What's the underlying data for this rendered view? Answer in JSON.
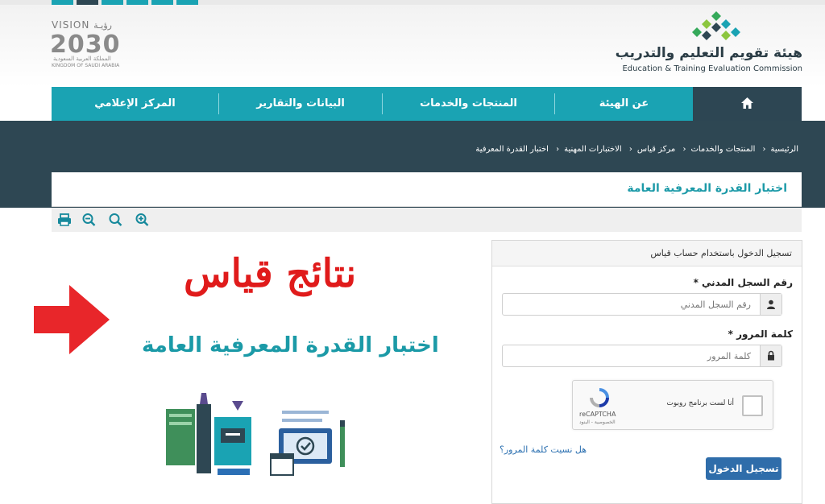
{
  "org": {
    "name_ar": "هيئة تقويم التعليم والتدريب",
    "name_en": "Education & Training Evaluation Commission"
  },
  "vision": {
    "label_en": "VISION",
    "label_ar": "رؤيـة",
    "year": "2030",
    "country_ar": "المملكة العربية السعودية",
    "country_en": "KINGDOM OF SAUDI ARABIA"
  },
  "nav": {
    "home_icon": "home-icon",
    "items": [
      "عن الهيئة",
      "المنتجات والخدمات",
      "البيانات والتقارير",
      "المركز الإعلامي"
    ]
  },
  "breadcrumb": [
    "الرئيسية",
    "المنتجات والخدمات",
    "مركز قياس",
    "الاختبارات المهنية",
    "اختبار القدرة المعرفية"
  ],
  "page": {
    "title": "اختبار القدرة المعرفية العامة"
  },
  "toolbar": {
    "tools": [
      "print-icon",
      "zoom-out-icon",
      "zoom-reset-icon",
      "zoom-in-icon"
    ]
  },
  "banner": {
    "headline": "نتائج قياس",
    "subtitle": "اختبار القدرة المعرفية العامة"
  },
  "login": {
    "header": "تسجيل الدخول باستخدام حساب قياس",
    "id_label": "رقم السجل المدني *",
    "id_placeholder": "رقم السجل المدني",
    "password_label": "كلمة المرور *",
    "password_placeholder": "كلمة المرور",
    "captcha_text": "أنا لست برنامج روبوت",
    "captcha_brand": "reCAPTCHA",
    "captcha_links": "الخصوصية - البنود",
    "forgot": "هل نسيت كلمة المرور؟",
    "submit": "تسجيل الدخول"
  },
  "colors": {
    "nav": "#1aa3b3",
    "dark": "#2e4753",
    "accent_text": "#1c9aa8",
    "headline": "#e01b1b",
    "button": "#2f6daa"
  }
}
